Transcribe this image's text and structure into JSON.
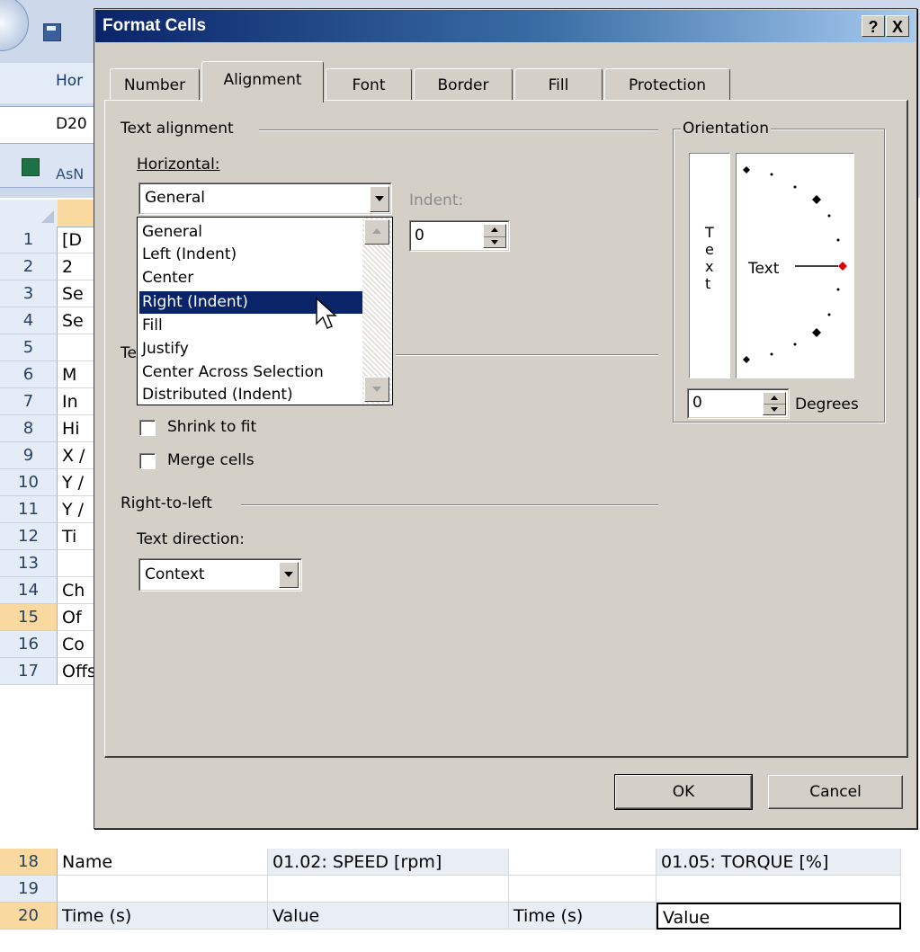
{
  "dialog": {
    "title": "Format Cells",
    "help_button": "?",
    "close_button": "X",
    "tabs": [
      "Number",
      "Alignment",
      "Font",
      "Border",
      "Fill",
      "Protection"
    ],
    "active_tab": "Alignment",
    "ok_label": "OK",
    "cancel_label": "Cancel"
  },
  "alignment": {
    "text_alignment_label": "Text alignment",
    "horizontal_label": "Horizontal:",
    "horizontal_value": "General",
    "horizontal_options": [
      "General",
      "Left (Indent)",
      "Center",
      "Right (Indent)",
      "Fill",
      "Justify",
      "Center Across Selection",
      "Distributed (Indent)"
    ],
    "highlighted_option": "Right (Indent)",
    "indent_label": "Indent:",
    "indent_value": "0",
    "text_control_label_partial": "Te",
    "shrink_label": "Shrink to fit",
    "shrink_checked": false,
    "merge_label": "Merge cells",
    "merge_checked": false,
    "rtl_label": "Right-to-left",
    "text_direction_label": "Text direction:",
    "text_direction_value": "Context"
  },
  "orientation": {
    "label": "Orientation",
    "vertical_text": [
      "T",
      "e",
      "x",
      "t"
    ],
    "dial_text": "Text",
    "degrees_value": "0",
    "degrees_label": "Degrees",
    "marker_color": "#e00000"
  },
  "excel_background": {
    "ribbon_tab": "Hor",
    "name_box": "D20",
    "workbook_name": "AsN",
    "rows": [
      {
        "num": "1",
        "a": "[D"
      },
      {
        "num": "2",
        "a": "2"
      },
      {
        "num": "3",
        "a": "Se"
      },
      {
        "num": "4",
        "a": "Se"
      },
      {
        "num": "5",
        "a": ""
      },
      {
        "num": "6",
        "a": "M"
      },
      {
        "num": "7",
        "a": "In"
      },
      {
        "num": "8",
        "a": "Hi"
      },
      {
        "num": "9",
        "a": "X /"
      },
      {
        "num": "10",
        "a": "Y /"
      },
      {
        "num": "11",
        "a": "Y /"
      },
      {
        "num": "12",
        "a": "Ti"
      },
      {
        "num": "13",
        "a": ""
      },
      {
        "num": "14",
        "a": "Ch"
      },
      {
        "num": "15",
        "a": "Of"
      },
      {
        "num": "16",
        "a": "Co"
      },
      {
        "num": "17",
        "a": "Offset"
      }
    ],
    "row18": {
      "num": "18",
      "a": "Name",
      "b": "01.02: SPEED [rpm]",
      "c": "",
      "d": "01.05: TORQUE [%]"
    },
    "row19": {
      "num": "19"
    },
    "row20": {
      "num": "20",
      "a": "Time (s)",
      "b": "Value",
      "c": "Time (s)",
      "d": "Value"
    }
  }
}
